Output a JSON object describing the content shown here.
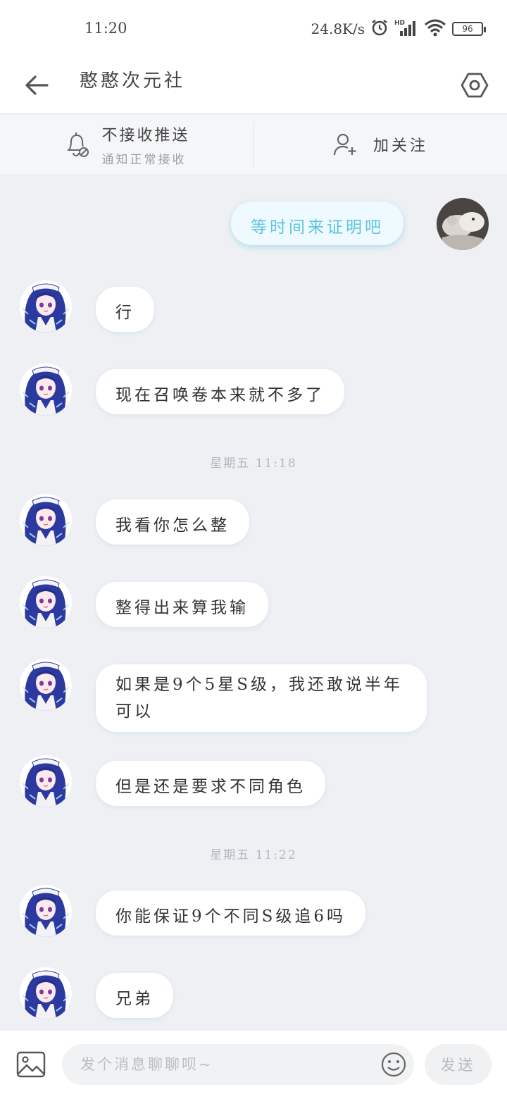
{
  "status_bar": {
    "time": "11:20",
    "net_speed": "24.8K/s",
    "battery": "96"
  },
  "header": {
    "title": "憨憨次元社"
  },
  "action_bar": {
    "push_title": "不接收推送",
    "push_subtitle": "通知正常接收",
    "follow_label": "加关注"
  },
  "messages": [
    {
      "text": "等时间来证明吧"
    },
    {
      "text": "行"
    },
    {
      "text": "现在召唤卷本来就不多了"
    },
    {
      "text": "我看你怎么整"
    },
    {
      "text": "整得出来算我输"
    },
    {
      "text": "如果是9个5星S级，我还敢说半年可以"
    },
    {
      "text": "但是还是要求不同角色"
    },
    {
      "text": "你能保证9个不同S级追6吗"
    },
    {
      "text": "兄弟"
    }
  ],
  "timestamps": [
    "星期五 11:18",
    "星期五 11:22"
  ],
  "input_bar": {
    "placeholder": "发个消息聊聊呗~",
    "send_label": "发送"
  },
  "colors": {
    "accent_bubble_text": "#5fc5dd",
    "avatar_hair": "#2c3aa0"
  }
}
